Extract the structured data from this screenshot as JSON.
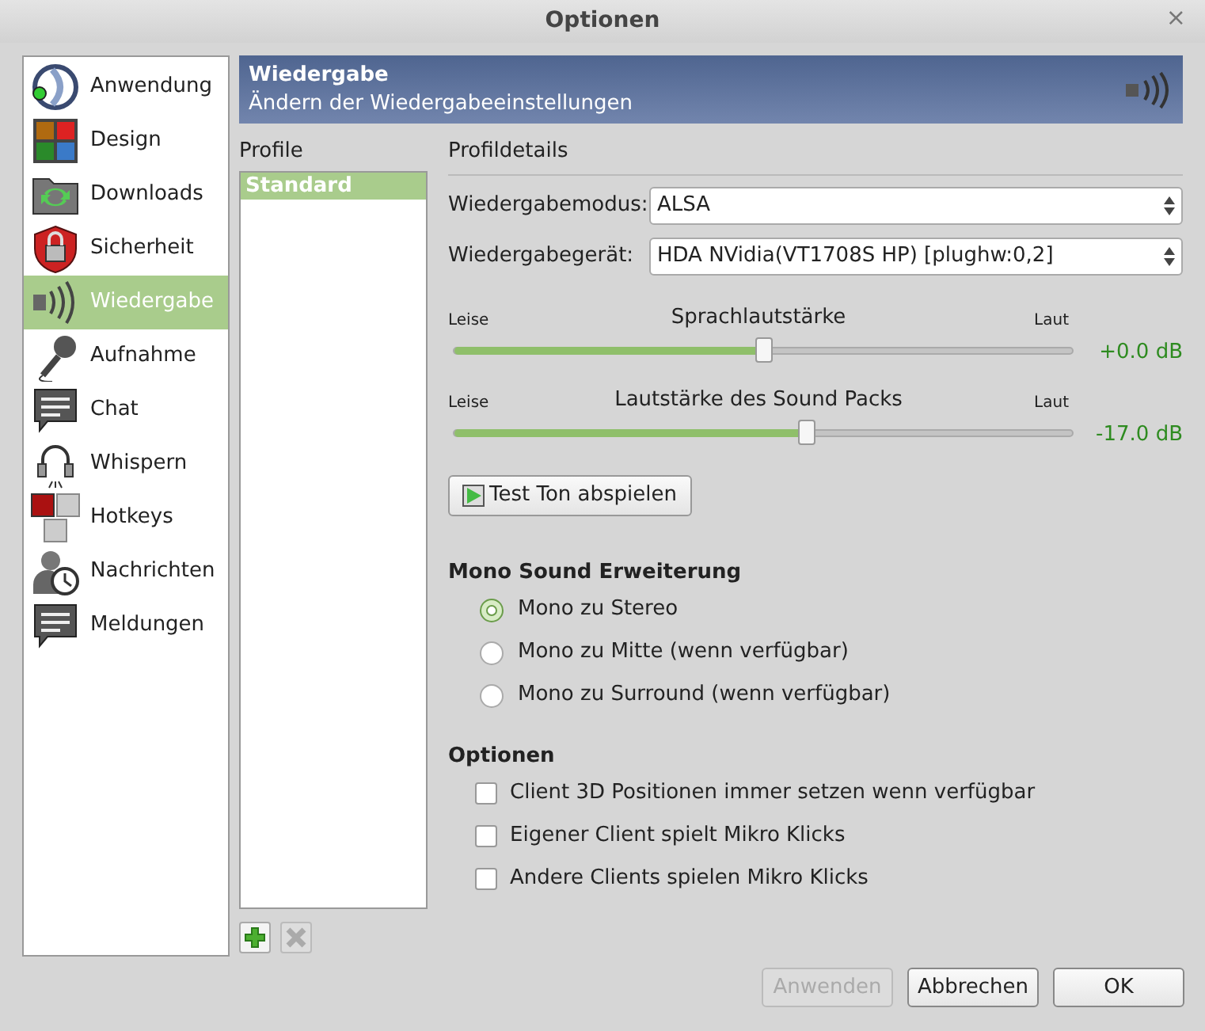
{
  "window": {
    "title": "Optionen",
    "close": "×"
  },
  "sidebar": {
    "items": [
      {
        "label": "Anwendung",
        "selected": false
      },
      {
        "label": "Design",
        "selected": false
      },
      {
        "label": "Downloads",
        "selected": false
      },
      {
        "label": "Sicherheit",
        "selected": false
      },
      {
        "label": "Wiedergabe",
        "selected": true
      },
      {
        "label": "Aufnahme",
        "selected": false
      },
      {
        "label": "Chat",
        "selected": false
      },
      {
        "label": "Whispern",
        "selected": false
      },
      {
        "label": "Hotkeys",
        "selected": false
      },
      {
        "label": "Nachrichten",
        "selected": false
      },
      {
        "label": "Meldungen",
        "selected": false
      }
    ]
  },
  "header": {
    "title": "Wiedergabe",
    "subtitle": "Ändern der Wiedergabeeinstellungen"
  },
  "profiles": {
    "heading": "Profile",
    "items": [
      {
        "label": "Standard",
        "selected": true
      }
    ]
  },
  "details": {
    "heading": "Profildetails",
    "fields": [
      {
        "label": "Wiedergabemodus:",
        "value": "ALSA"
      },
      {
        "label": "Wiedergabegerät:",
        "value": "HDA NVidia(VT1708S HP) [plughw:0,2]"
      }
    ],
    "sliders": [
      {
        "title": "Sprachlautstärke",
        "min_label": "Leise",
        "max_label": "Laut",
        "level": 0.5,
        "reading": "+0.0 dB"
      },
      {
        "title": "Lautstärke des Sound Packs",
        "min_label": "Leise",
        "max_label": "Laut",
        "level": 0.57,
        "reading": "-17.0 dB"
      }
    ],
    "test_button": "Test Ton abspielen",
    "mono": {
      "heading": "Mono Sound Erweiterung",
      "options": [
        {
          "label": "Mono zu Stereo",
          "selected": true
        },
        {
          "label": "Mono zu Mitte (wenn verfügbar)",
          "selected": false
        },
        {
          "label": "Mono zu Surround (wenn verfügbar)",
          "selected": false
        }
      ]
    },
    "options": {
      "heading": "Optionen",
      "items": [
        {
          "label": "Client 3D Positionen immer setzen wenn verfügbar",
          "checked": false
        },
        {
          "label": "Eigener Client spielt Mikro Klicks",
          "checked": false
        },
        {
          "label": "Andere Clients spielen Mikro Klicks",
          "checked": false
        }
      ]
    }
  },
  "buttons": [
    {
      "label": "Anwenden",
      "disabled": true
    },
    {
      "label": "Abbrechen",
      "disabled": false
    },
    {
      "label": "OK",
      "disabled": false
    }
  ]
}
